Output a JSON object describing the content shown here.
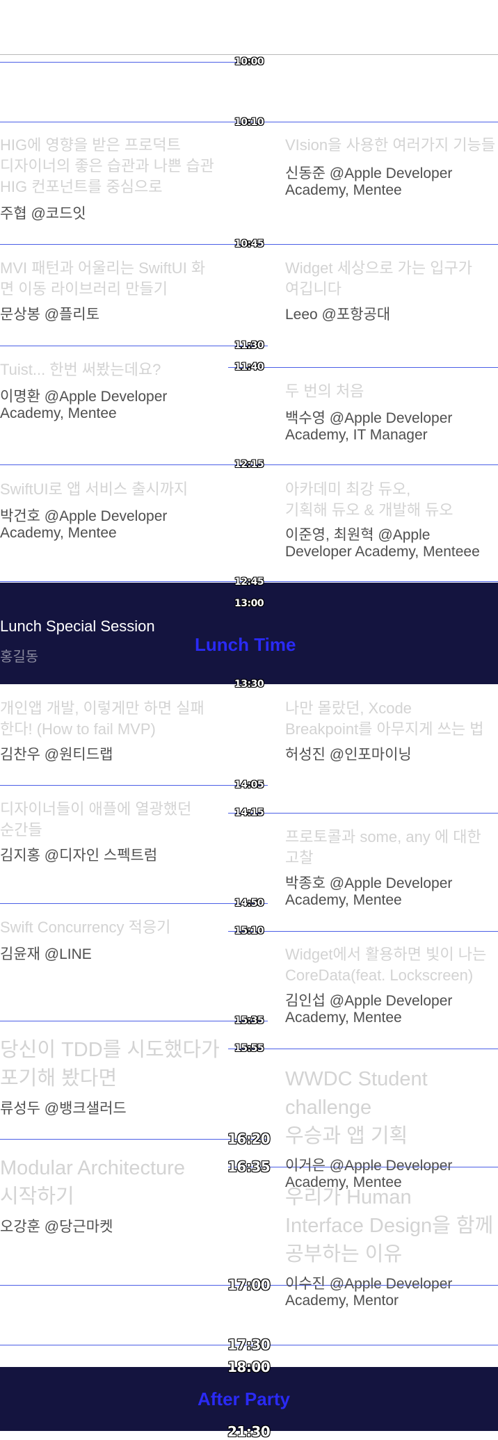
{
  "colors": {
    "line": "#4a5ee6",
    "band": "#14143f",
    "band_text": "#2a2af5",
    "title": "#d3d3d3",
    "speaker": "#4f4f4f"
  },
  "times": {
    "t1000": "10:00",
    "t1010": "10:10",
    "t1045": "10:45",
    "t1130": "11:30",
    "t1140": "11:40",
    "t1215": "12:15",
    "t1245": "12:45",
    "t1300": "13:00",
    "t1330": "13:30",
    "t1405": "14:05",
    "t1415": "14:15",
    "t1450": "14:50",
    "t1510": "15:10",
    "t1535": "15:35",
    "t1555": "15:55",
    "t1620": "16:20",
    "t1635": "16:35",
    "t1700": "17:00",
    "t1730": "17:30",
    "t1800": "18:00",
    "t2130": "21:30"
  },
  "sessions": {
    "s1": {
      "title": "HIG에 영향을 받은 프로덕트\n디자이너의 좋은 습관과 나쁜 습관\nHIG 컨포넌트를 중심으로",
      "speaker": "주협 @코드잇"
    },
    "s2": {
      "title": "VIsion을 사용한 여러가지 기능들",
      "speaker": "신동준 @Apple Developer\nAcademy, Mentee"
    },
    "s3": {
      "title": "MVI 패턴과 어울리는 SwiftUI 화\n면 이동 라이브러리 만들기",
      "speaker": "문상봉 @플리토"
    },
    "s4": {
      "title": "Widget 세상으로 가는 입구가\n여깁니다",
      "speaker": "Leeo @포항공대"
    },
    "s5": {
      "title": "Tuist... 한번 써봤는데요?",
      "speaker": "이명환 @Apple Developer\nAcademy, Mentee"
    },
    "s6": {
      "title": "두 번의 처음",
      "speaker": "백수영 @Apple Developer\nAcademy, IT Manager"
    },
    "s7": {
      "title": "SwiftUI로 앱 서비스 출시까지",
      "speaker": "박건호 @Apple Developer\nAcademy, Mentee"
    },
    "s8": {
      "title": "아카데미 최강 듀오,\n기획해 듀오 & 개발해 듀오",
      "speaker": "이준영, 최원혁 @Apple\nDeveloper Academy, Menteee"
    },
    "lunch_session": {
      "title": "Lunch Special Session",
      "speaker": "홍길동"
    },
    "lunch_time": "Lunch Time",
    "s9": {
      "title": "개인앱 개발, 이렇게만 하면 실패\n한다! (How to fail MVP)",
      "speaker": "김찬우 @원티드랩"
    },
    "s10": {
      "title": "나만 몰랐던, Xcode\nBreakpoint를 아무지게 쓰는 법",
      "speaker": "허성진 @인포마이닝"
    },
    "s11": {
      "title": "디자이너들이 애플에 열광했던\n순간들",
      "speaker": "김지홍 @디자인 스펙트럼"
    },
    "s12": {
      "title": "프로토콜과 some, any 에 대한\n고찰",
      "speaker": "박종호 @Apple Developer\nAcademy, Mentee"
    },
    "s13": {
      "title": "Swift Concurrency 적응기",
      "speaker": "김윤재 @LINE"
    },
    "s14": {
      "title": "Widget에서 활용하면 빛이 나는\nCoreData(feat. Lockscreen)",
      "speaker": "김인섭 @Apple Developer\nAcademy, Mentee"
    },
    "s15": {
      "title": "당신이 TDD를 시도했다가\n포기해 봤다면",
      "speaker": "류성두 @뱅크샐러드"
    },
    "s16": {
      "title": "WWDC Student\nchallenge\n우승과 앱 기획",
      "speaker": "이거은 @Apple Developer\nAcademy, Mentee"
    },
    "s17": {
      "title": "Modular Architecture\n시작하기",
      "speaker": "오강훈 @당근마켓"
    },
    "s18": {
      "title": "우리가 Human\nInterface Design을 함께\n공부하는 이유",
      "speaker": "이수진 @Apple Developer\nAcademy, Mentor"
    },
    "after_party": "After Party"
  }
}
